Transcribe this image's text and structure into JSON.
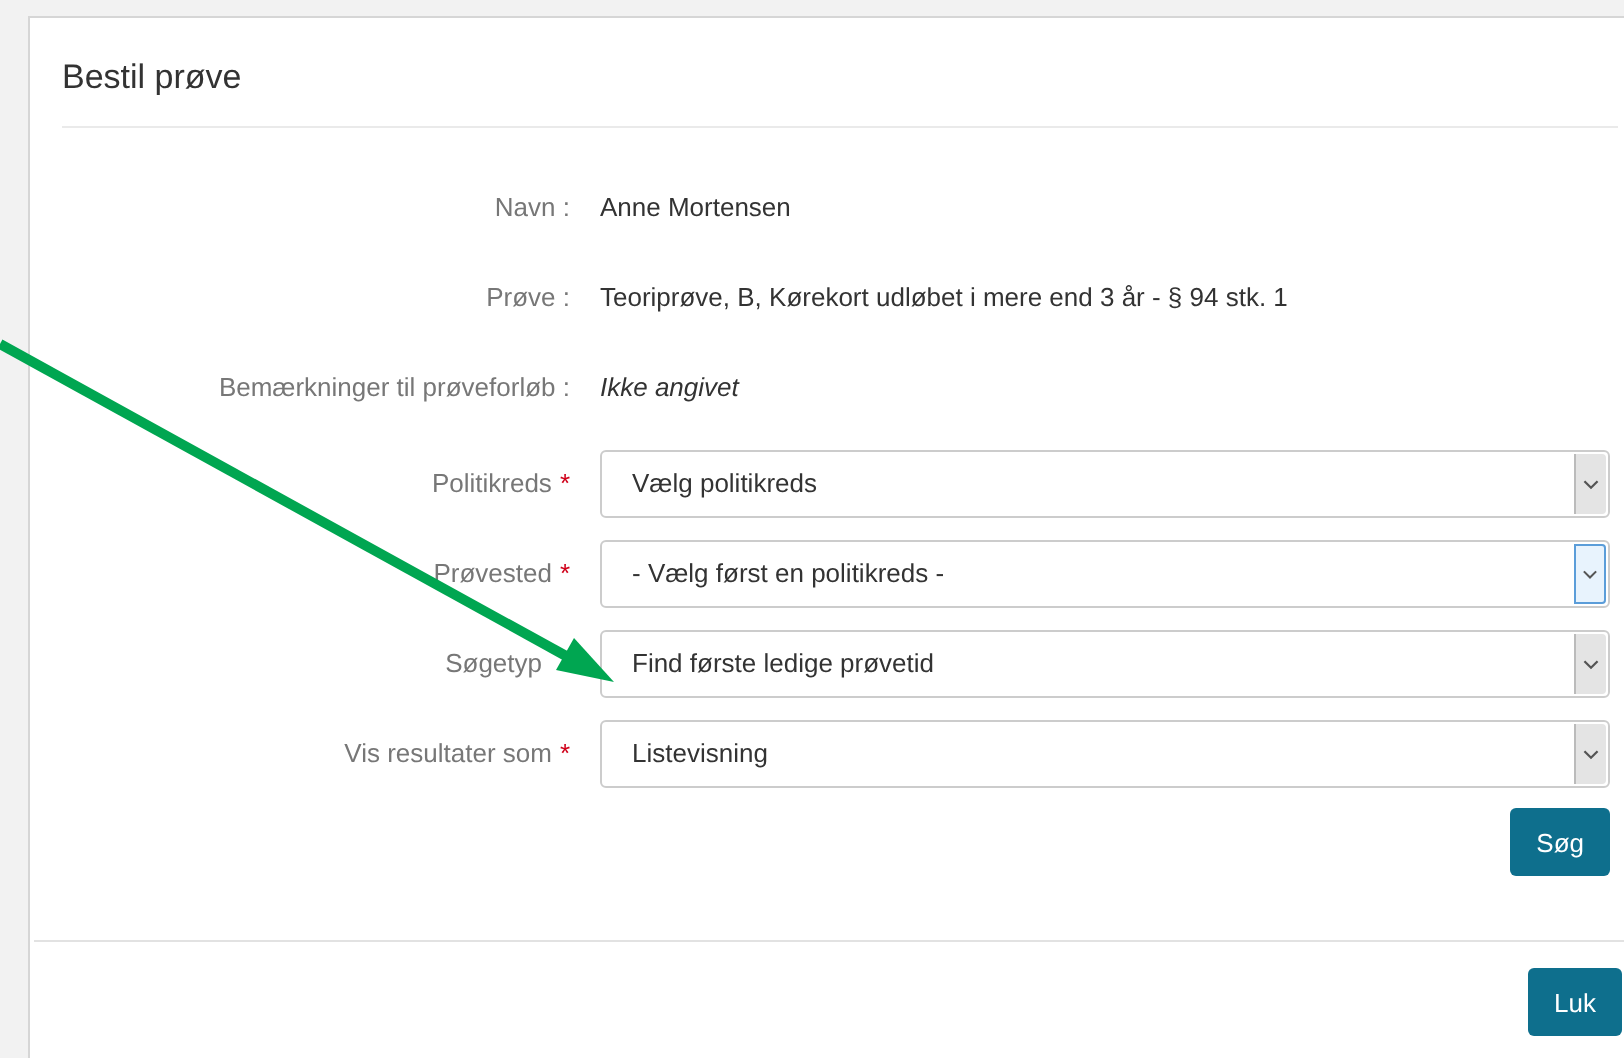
{
  "dialog": {
    "title": "Bestil prøve",
    "info": [
      {
        "label": "Navn :",
        "value": "Anne Mortensen",
        "kind": "plain"
      },
      {
        "label": "Prøve :",
        "value": "Teoriprøve, B, Kørekort udløbet i mere end 3 år - § 94 stk. 1",
        "kind": "plain"
      },
      {
        "label": "Bemærkninger til prøveforløb :",
        "value": "Ikke angivet",
        "kind": "italic"
      }
    ],
    "fields": [
      {
        "label": "Politikreds",
        "required_mark": "*",
        "value": "Vælg politikreds",
        "focused": false
      },
      {
        "label": "Prøvested",
        "required_mark": "*",
        "value": "- Vælg først en politikreds -",
        "focused": true
      },
      {
        "label": "Søgetyp",
        "value": "Find første ledige prøvetid",
        "focused": false
      },
      {
        "label": "Vis resultater som",
        "required_mark": "*",
        "value": "Listevisning",
        "focused": false
      }
    ],
    "search_button": "Søg",
    "close_button": "Luk"
  },
  "annotation": {
    "kind": "arrow",
    "color": "#00a651"
  }
}
